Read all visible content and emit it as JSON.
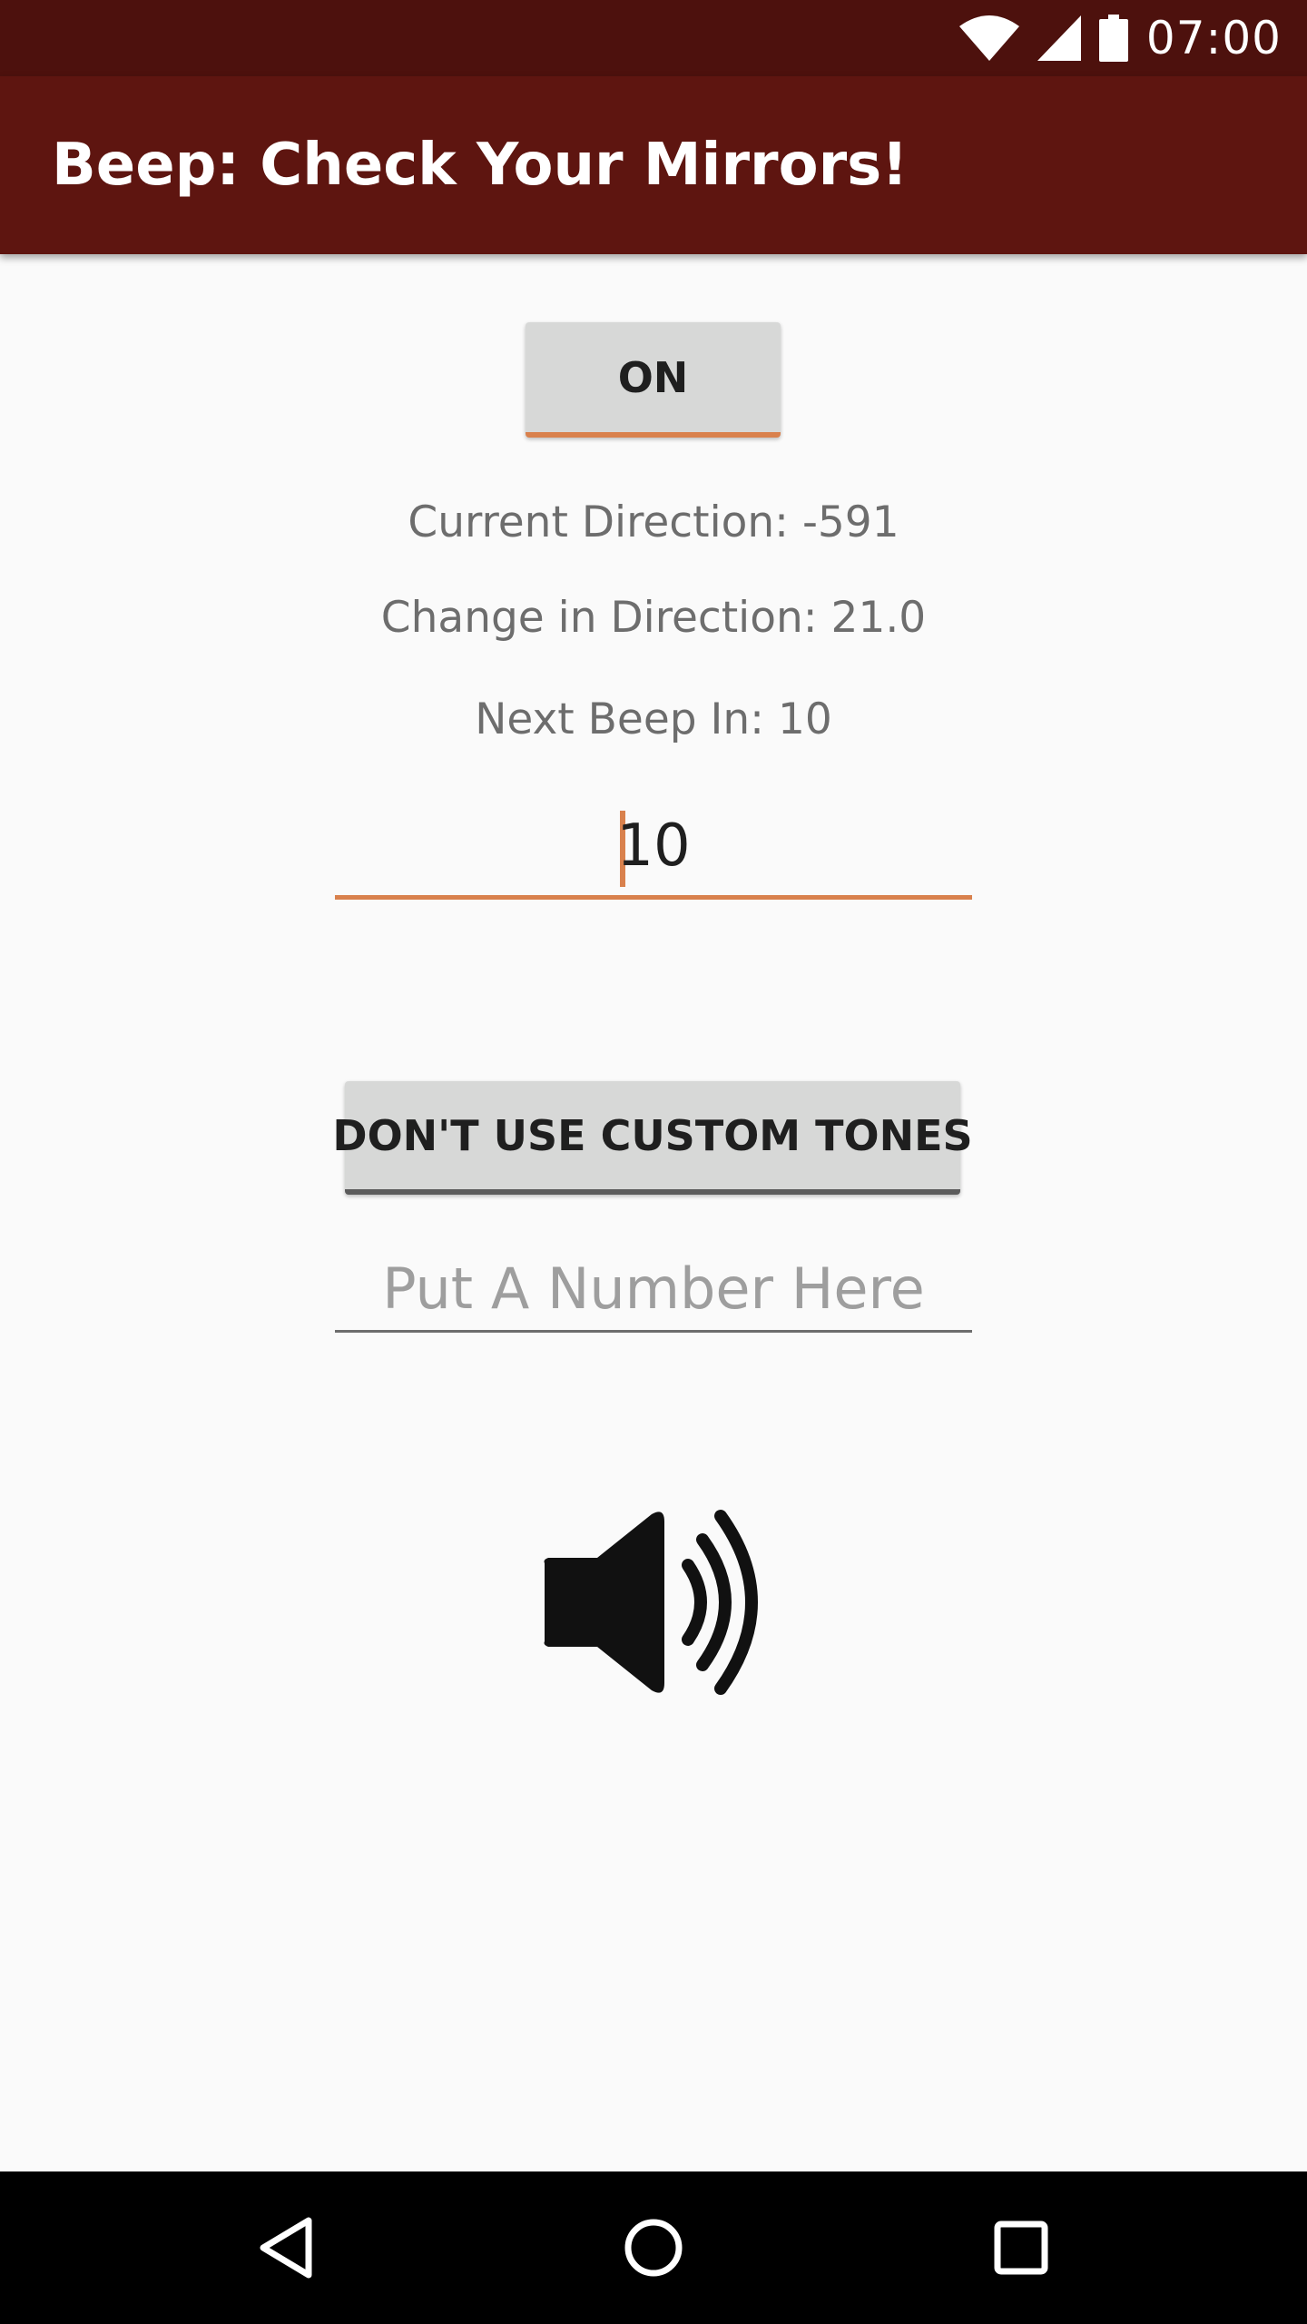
{
  "status_bar": {
    "time": "07:00",
    "icons": [
      "wifi-icon",
      "cellular-signal-icon",
      "battery-icon"
    ],
    "background": "#4d110d"
  },
  "app_bar": {
    "title": "Beep: Check Your Mirrors!",
    "background": "#5e1510"
  },
  "controls": {
    "on_button_label": "ON",
    "current_direction": "Current Direction: -591",
    "change_in_direction": "Change in Direction: 21.0",
    "next_beep": "Next Beep In: 10",
    "interval_value": "10",
    "custom_tones_button_label": "DON'T USE CUSTOM TONES",
    "tone_placeholder": "Put A Number Here",
    "tone_value": "",
    "speaker_icon": "speaker-volume-icon",
    "accent": "#d9814d"
  },
  "nav_bar": {
    "icons": [
      "back-icon",
      "home-icon",
      "recents-icon"
    ]
  }
}
